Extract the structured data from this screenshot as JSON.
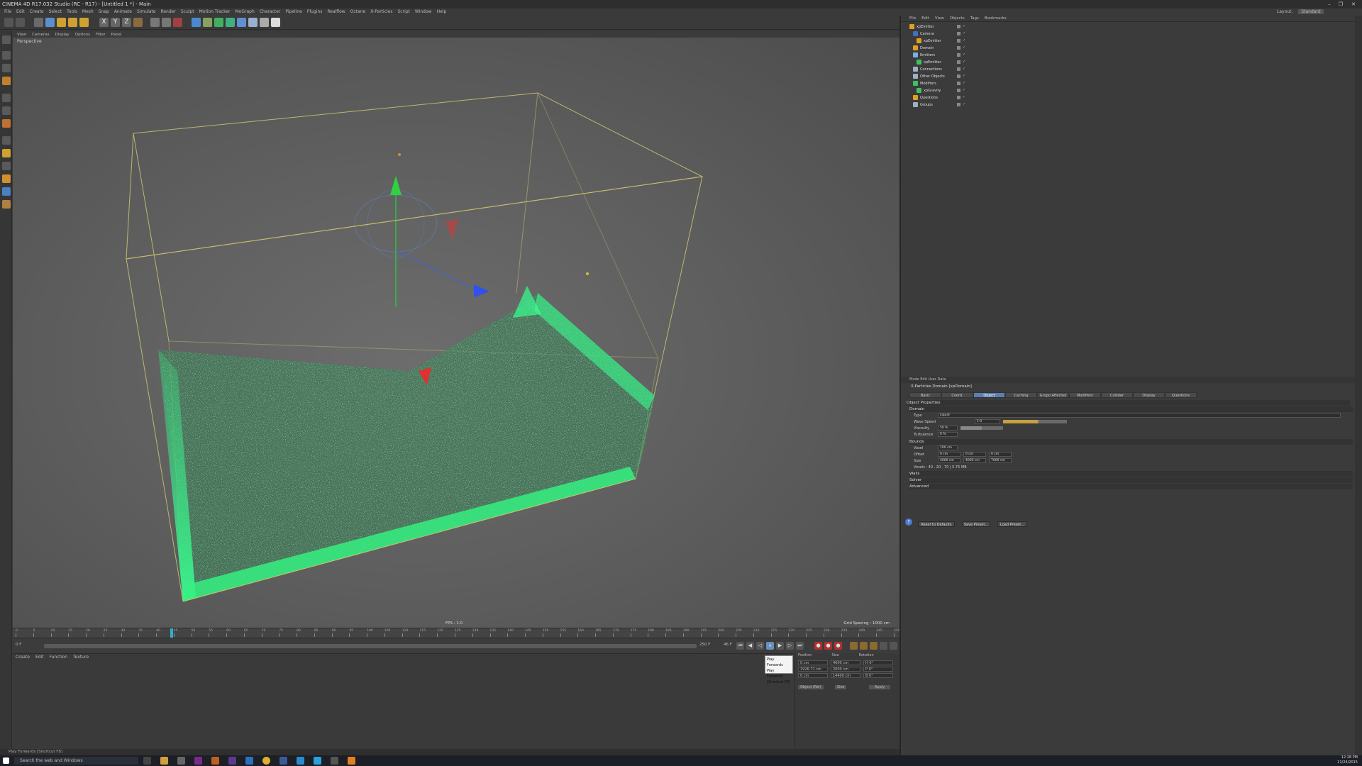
{
  "window": {
    "title": "CINEMA 4D R17.032 Studio (RC - R17) - [Untitled 1 *] - Main"
  },
  "menubar": [
    "File",
    "Edit",
    "Create",
    "Select",
    "Tools",
    "Mesh",
    "Snap",
    "Animate",
    "Simulate",
    "Render",
    "Sculpt",
    "Motion Tracker",
    "MoGraph",
    "Character",
    "Pipeline",
    "Plugins",
    "Realflow",
    "Octane",
    "X-Particles",
    "Script",
    "Window",
    "Help"
  ],
  "layout": {
    "label": "Layout:",
    "value": "Standard"
  },
  "viewport": {
    "menu": [
      "View",
      "Cameras",
      "Display",
      "Options",
      "Filter",
      "Panel"
    ],
    "label": "Perspective",
    "fps": "FPS : 1.0",
    "grid_spacing": "Grid Spacing : 1000 cm"
  },
  "timeline": {
    "ticks": [
      "0",
      "5",
      "10",
      "15",
      "20",
      "25",
      "30",
      "35",
      "40",
      "45",
      "50",
      "55",
      "60",
      "65",
      "70",
      "75",
      "80",
      "85",
      "90",
      "95",
      "100",
      "105",
      "110",
      "115",
      "120",
      "125",
      "130",
      "135",
      "140",
      "145",
      "150",
      "155",
      "160",
      "165",
      "170",
      "175",
      "180",
      "185",
      "190",
      "195",
      "200",
      "205",
      "210",
      "215",
      "220",
      "225",
      "230",
      "235",
      "240",
      "245",
      "250"
    ],
    "current_frame": "46 F",
    "start": "0 F",
    "end": "250 F"
  },
  "tooltip": {
    "lines": [
      "Play Forwards",
      "Play Forwards",
      "[Shortcut F8]"
    ]
  },
  "material_manager": {
    "menu": [
      "Create",
      "Edit",
      "Function",
      "Texture"
    ]
  },
  "coordinates": {
    "headers": [
      "Position",
      "Size",
      "Rotation"
    ],
    "rows": [
      {
        "a": "0 cm",
        "b": "4000 cm",
        "c": "H 0°"
      },
      {
        "a": "1926.71 cm",
        "b": "2000 cm",
        "c": "P 0°"
      },
      {
        "a": "0 cm",
        "b": "14400 cm",
        "c": "B 0°"
      }
    ],
    "mode": "Object (Rel)",
    "size_mode": "Size",
    "apply": "Apply"
  },
  "statusbar": "Play Forwards [Shortcut F8]",
  "object_manager": {
    "menu": [
      "File",
      "Edit",
      "View",
      "Objects",
      "Tags",
      "Bookmarks"
    ],
    "objects": [
      {
        "name": "xpEmitter",
        "color": "#e0a020",
        "indent": 0
      },
      {
        "name": "Camera",
        "color": "#4070c0",
        "indent": 1
      },
      {
        "name": "xpEmitter",
        "color": "#e0a020",
        "indent": 2
      },
      {
        "name": "Domain",
        "color": "#e0a020",
        "indent": 1
      },
      {
        "name": "Emitters",
        "color": "#7ab0e0",
        "indent": 1
      },
      {
        "name": "xpEmitter",
        "color": "#40c060",
        "indent": 2
      },
      {
        "name": "Connections",
        "color": "#9fb0c0",
        "indent": 1
      },
      {
        "name": "Other Objects",
        "color": "#9fb0c0",
        "indent": 1
      },
      {
        "name": "Modifiers",
        "color": "#40c060",
        "indent": 1
      },
      {
        "name": "xpGravity",
        "color": "#40c060",
        "indent": 2
      },
      {
        "name": "Questions",
        "color": "#e0a020",
        "indent": 1
      },
      {
        "name": "Groups",
        "color": "#9fb0c0",
        "indent": 1
      }
    ]
  },
  "attributes": {
    "menu": "Mode  Edit  User Data",
    "title": "X-Particles Domain [xpDomain]",
    "tabs": [
      "Basic",
      "Coord.",
      "Object",
      "Caching",
      "Grupo Affected",
      "Modifiers",
      "Collider",
      "Display",
      "Questions"
    ],
    "selected_tab": "Object",
    "section_properties": "Object Properties",
    "section_domain": "Domain",
    "type_label": "Type",
    "type_value": "Liquid",
    "wave_label": "Wave Speed",
    "wave_value": "1.0",
    "viscosity_label": "Viscosity",
    "viscosity_value": "50 %",
    "turbulence_label": "Turbulence",
    "turbulence_value": "0 %",
    "section_bounds": "Bounds",
    "voxel_label": "Voxel",
    "voxel_value": "100 cm",
    "offset_label": "Offset",
    "offset_values": [
      "0 cm",
      "0 cm",
      "0 cm"
    ],
    "size_label": "Size",
    "size_values": [
      "4000 cm",
      "4000 cm",
      "7000 cm"
    ],
    "info": "Voxels : 40 . 20 . 70 | 5.75 MB",
    "collapsed": [
      "Walls",
      "Solver",
      "Advanced"
    ],
    "buttons": [
      "Reset to Defaults",
      "Save Preset...",
      "Load Preset..."
    ]
  },
  "taskbar": {
    "search_placeholder": "Search the web and Windows",
    "time": "12:28 PM",
    "date": "11/24/2015"
  }
}
